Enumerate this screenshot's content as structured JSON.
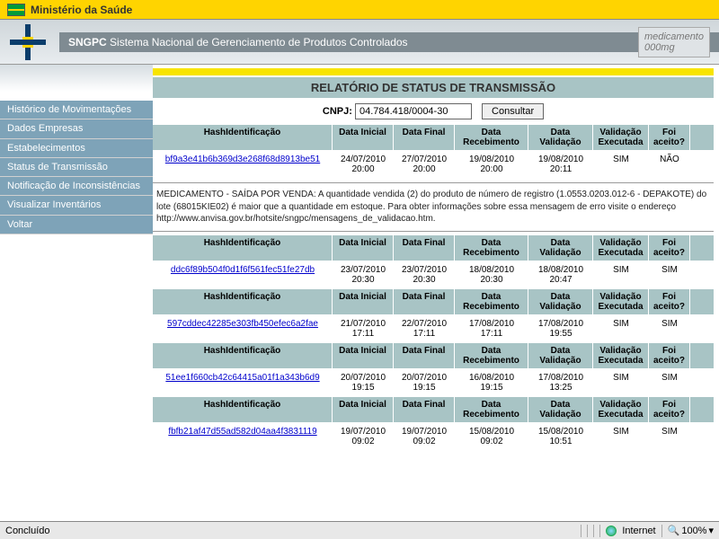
{
  "top": {
    "ministry": "Ministério da Saúde"
  },
  "header": {
    "acronym": "SNGPC",
    "full": "Sistema Nacional de Gerenciamento de Produtos Controlados",
    "med_label": "medicamento",
    "med_dose": "000mg"
  },
  "sidebar": {
    "items": [
      "Histórico de Movimentações",
      "Dados Empresas",
      "Estabelecimentos",
      "Status de Transmissão",
      "Notificação de Inconsistências",
      "Visualizar Inventários",
      "Voltar"
    ]
  },
  "report": {
    "title": "RELATÓRIO DE STATUS DE TRANSMISSÃO",
    "cnpj_label": "CNPJ:",
    "cnpj_value": "04.784.418/0004-30",
    "consult_btn": "Consultar"
  },
  "columns": {
    "hash": "HashIdentificação",
    "di": "Data Inicial",
    "df": "Data Final",
    "dr": "Data Recebimento",
    "dv": "Data Validação",
    "ve": "Validação Executada",
    "fa": "Foi aceito?"
  },
  "rows": [
    {
      "hash": "bf9a3e41b6b369d3e268f68d8913be51",
      "di": "24/07/2010 20:00",
      "df": "27/07/2010 20:00",
      "dr": "19/08/2010 20:00",
      "dv": "19/08/2010 20:11",
      "ve": "SIM",
      "fa": "NÃO"
    },
    {
      "hash": "ddc6f89b504f0d1f6f561fec51fe27db",
      "di": "23/07/2010 20:30",
      "df": "23/07/2010 20:30",
      "dr": "18/08/2010 20:30",
      "dv": "18/08/2010 20:47",
      "ve": "SIM",
      "fa": "SIM"
    },
    {
      "hash": "597cddec42285e303fb450efec6a2fae",
      "di": "21/07/2010 17:11",
      "df": "22/07/2010 17:11",
      "dr": "17/08/2010 17:11",
      "dv": "17/08/2010 19:55",
      "ve": "SIM",
      "fa": "SIM"
    },
    {
      "hash": "51ee1f660cb42c64415a01f1a343b6d9",
      "di": "20/07/2010 19:15",
      "df": "20/07/2010 19:15",
      "dr": "16/08/2010 19:15",
      "dv": "17/08/2010 13:25",
      "ve": "SIM",
      "fa": "SIM"
    },
    {
      "hash": "fbfb21af47d55ad582d04aa4f3831119",
      "di": "19/07/2010 09:02",
      "df": "19/07/2010 09:02",
      "dr": "15/08/2010 09:02",
      "dv": "15/08/2010 10:51",
      "ve": "SIM",
      "fa": "SIM"
    }
  ],
  "note": "MEDICAMENTO - SAÍDA POR VENDA: A quantidade vendida (2) do produto de número de registro (1.0553.0203.012-6 - DEPAKOTE) do lote (68015KIE02) é maior que a quantidade em estoque. Para obter informações sobre essa mensagem de erro visite o endereço http://www.anvisa.gov.br/hotsite/sngpc/mensagens_de_validacao.htm.",
  "status": {
    "left": "Concluído",
    "net": "Internet",
    "zoom": "100%"
  }
}
